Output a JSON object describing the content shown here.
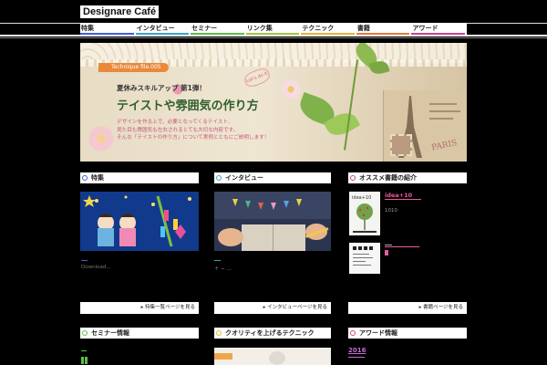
{
  "site": {
    "title": "Designare Café"
  },
  "nav": {
    "items": [
      {
        "label": "特集",
        "color": "#3f5fd8"
      },
      {
        "label": "インタビュー",
        "color": "#3aa6c9"
      },
      {
        "label": "セミナー",
        "color": "#5fbf4a"
      },
      {
        "label": "リンク集",
        "color": "#a2c63d"
      },
      {
        "label": "テクニック",
        "color": "#e3b33a"
      },
      {
        "label": "書籍",
        "color": "#e77a3a"
      },
      {
        "label": "アワード",
        "color": "#c9448f"
      }
    ]
  },
  "hero": {
    "tag": "Technique  file.005",
    "badge": "Let's do it",
    "subtitle": "夏休みスキルアップ 第1弾！",
    "title": "テイストや雰囲気の作り方",
    "desc": [
      "デザインを作る上で、必要となってくるテイスト、",
      "見た目も雰囲気も左右されるとても大切な内容です。",
      "そんな「テイストの作り方」について実例とともにご説明します！"
    ]
  },
  "sections": {
    "feature": {
      "title": "特集",
      "dot_color": "#3f5fd8",
      "caption": "Download...",
      "more": "▸ 特集一覧ページを見る"
    },
    "interview": {
      "title": "インタビュー",
      "dot_color": "#3aa6c9",
      "caption": "＋ − ...",
      "more": "▸ インタビューページを見る"
    },
    "books": {
      "title": "オススメ書籍の紹介",
      "dot_color": "#c9448f",
      "book_title": "idea+10",
      "book_sub": "1010",
      "more": "▸ 書籍ページを見る"
    },
    "seminar": {
      "title": "セミナー情報",
      "dot_color": "#5fbf4a"
    },
    "technique": {
      "title": "クオリティを上げるテクニック",
      "dot_color": "#e3b33a"
    },
    "award": {
      "title": "アワード情報",
      "dot_color": "#c9448f",
      "year": "2016"
    }
  }
}
